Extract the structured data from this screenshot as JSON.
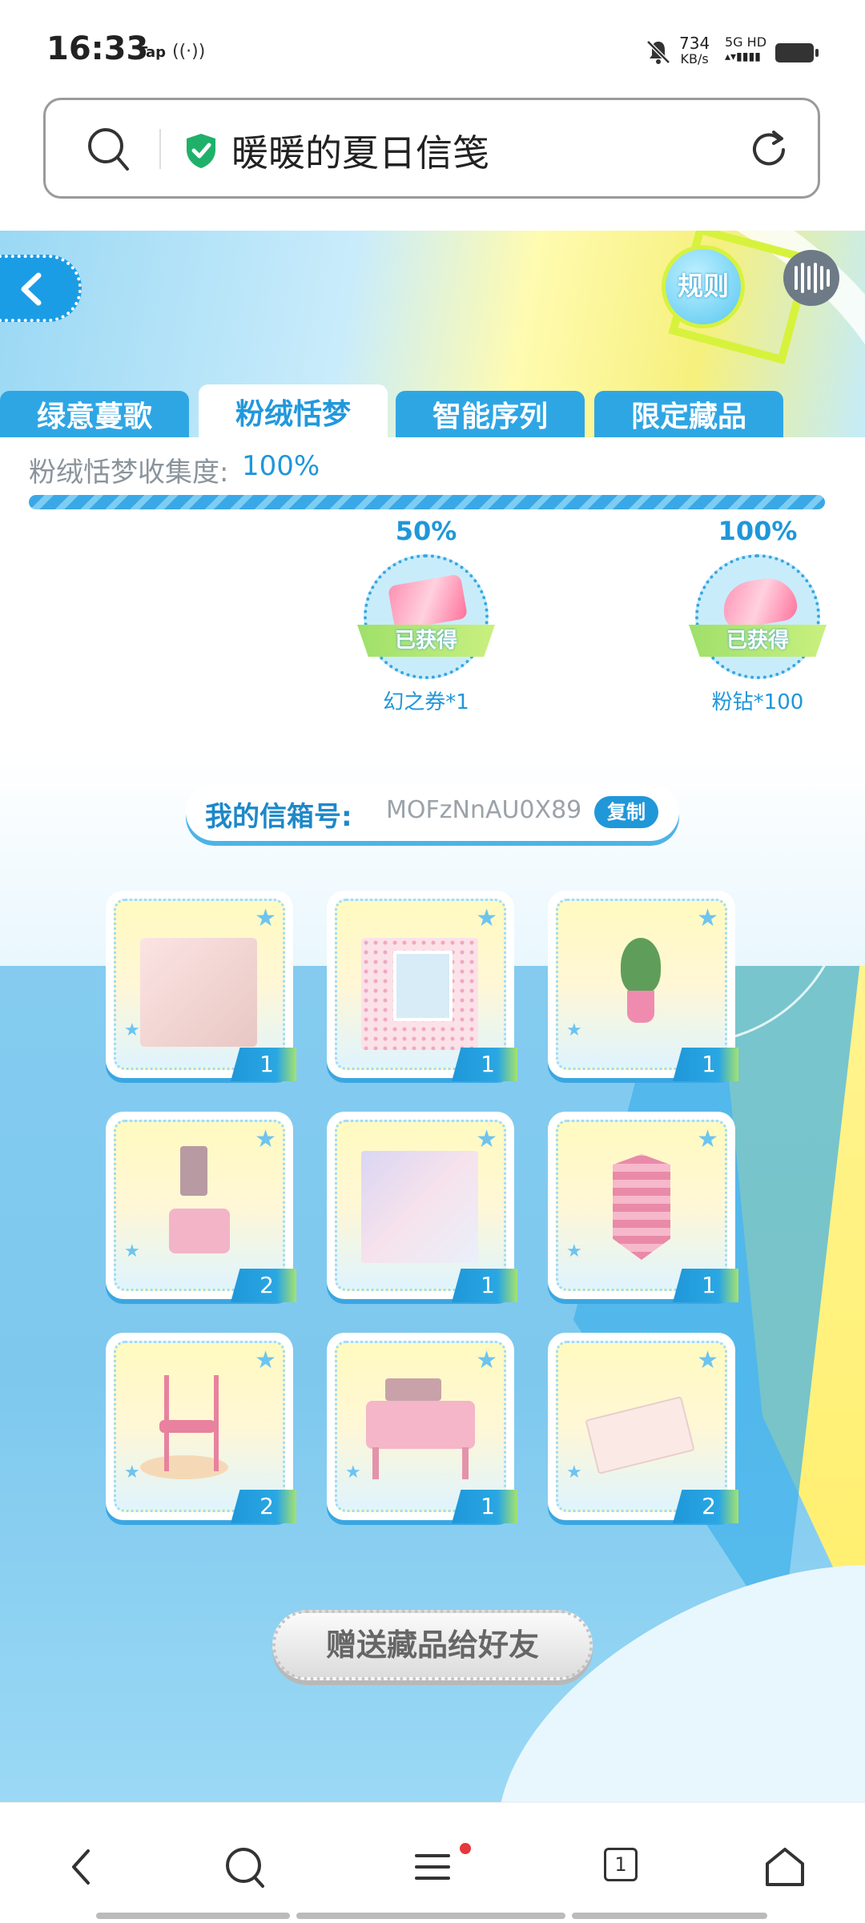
{
  "status_bar": {
    "time": "16:33",
    "tap_label": "Tap",
    "speed_value": "734",
    "speed_unit": "KB/s",
    "network": "5G HD"
  },
  "address_bar": {
    "title": "暖暖的夏日信笺"
  },
  "header": {
    "rules_label": "规则"
  },
  "tabs": [
    {
      "label": "绿意蔓歌",
      "active": false
    },
    {
      "label": "粉绒恬梦",
      "active": true
    },
    {
      "label": "智能序列",
      "active": false
    },
    {
      "label": "限定藏品",
      "active": false
    }
  ],
  "collection": {
    "label": "粉绒恬梦收集度:",
    "value": "100%",
    "progress_fraction": 1.0,
    "milestones": [
      {
        "percent": "50%",
        "status": "已获得",
        "reward": "幻之券*1"
      },
      {
        "percent": "100%",
        "status": "已获得",
        "reward": "粉钻*100"
      }
    ]
  },
  "mailbox": {
    "label": "我的信箱号:",
    "value": "MOFzNnAU0X89",
    "copy_label": "复制"
  },
  "items": [
    {
      "icon": "floor-icon",
      "count": "1"
    },
    {
      "icon": "wallpaper-window-icon",
      "count": "1"
    },
    {
      "icon": "potted-plant-icon",
      "count": "1"
    },
    {
      "icon": "wall-decor-set-icon",
      "count": "2"
    },
    {
      "icon": "painting-icon",
      "count": "1"
    },
    {
      "icon": "pink-cabinet-icon",
      "count": "1"
    },
    {
      "icon": "pink-chair-icon",
      "count": "2"
    },
    {
      "icon": "vanity-desk-icon",
      "count": "1"
    },
    {
      "icon": "letter-envelope-icon",
      "count": "2"
    }
  ],
  "gift_button": "赠送藏品给好友",
  "bottom_nav": {
    "tab_count": "1"
  },
  "colors": {
    "accent": "#1f97d9",
    "tab_bg": "#2fa6e4",
    "highlight_green": "#d7f23c"
  }
}
